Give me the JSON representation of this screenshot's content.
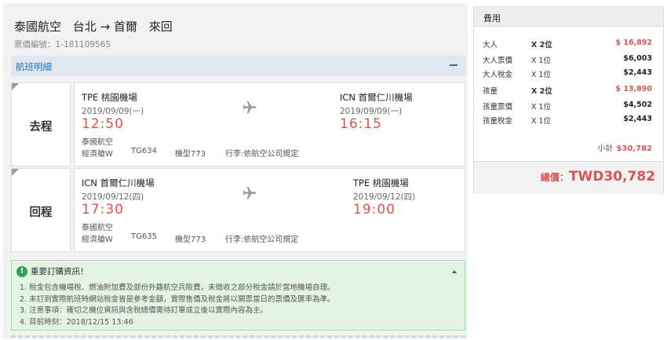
{
  "header": {
    "airline": "泰國航空",
    "route": "台北 → 首爾",
    "trip_type": "來回",
    "ticket_label": "票價編號：",
    "ticket_code": "1-181109565"
  },
  "section": {
    "title": "航班明細"
  },
  "flights": [
    {
      "direction": "去程",
      "from_airport": "TPE 桃園機場",
      "from_date": "2019/09/09(一)",
      "from_time": "12:50",
      "to_airport": "ICN 首爾仁川機場",
      "to_date": "2019/09/09(一)",
      "to_time": "16:15",
      "airline": "泰國航空",
      "cabin": "經濟艙W",
      "flight_no": "TG634",
      "aircraft": "機型773",
      "baggage": "行李:依航空公司規定"
    },
    {
      "direction": "回程",
      "from_airport": "ICN 首爾仁川機場",
      "from_date": "2019/09/12(四)",
      "from_time": "17:30",
      "to_airport": "TPE 桃園機場",
      "to_date": "2019/09/12(四)",
      "to_time": "19:00",
      "airline": "泰國航空",
      "cabin": "經濟艙W",
      "flight_no": "TG635",
      "aircraft": "機型773",
      "baggage": "行李:依航空公司規定"
    }
  ],
  "notice": {
    "title": "重要訂購資訊！",
    "items": [
      "1. 稅金包含機場稅、燃油附加費及部份外籍航空兵險費，未徵收之部分稅金請於當地機場自理。",
      "2. 未訂到實際航班時網站稅金皆是參考金額，實際售價及稅金將以開票當日的票價及匯率為準。",
      "3. 注意事項：確切之機位資訊與含稅總價需待訂單成立後以實際內容為主。",
      "4. 目前時刻：2018/12/15 13:46"
    ]
  },
  "fees": {
    "title": "費用",
    "rows": [
      {
        "label": "大人",
        "qty": "X 2位",
        "amount": "$ 16,892",
        "bold": true
      },
      {
        "label": "大人票價",
        "qty": "X 1位",
        "amount": "$6,003",
        "bold": false
      },
      {
        "label": "大人稅金",
        "qty": "X 1位",
        "amount": "$2,443",
        "bold": false
      },
      {
        "label": "孩童",
        "qty": "X 2位",
        "amount": "$ 13,890",
        "bold": true
      },
      {
        "label": "孩童票價",
        "qty": "X 1位",
        "amount": "$4,502",
        "bold": false
      },
      {
        "label": "孩童稅金",
        "qty": "X 1位",
        "amount": "$2,443",
        "bold": false
      }
    ],
    "subtotal_label": "小計",
    "subtotal_value": "$30,782",
    "total_label": "總價：",
    "total_value": "TWD30,782"
  },
  "colors": {
    "accent_red": "#e05252",
    "link_blue": "#2a72b5",
    "notice_green": "#2ea44f"
  }
}
